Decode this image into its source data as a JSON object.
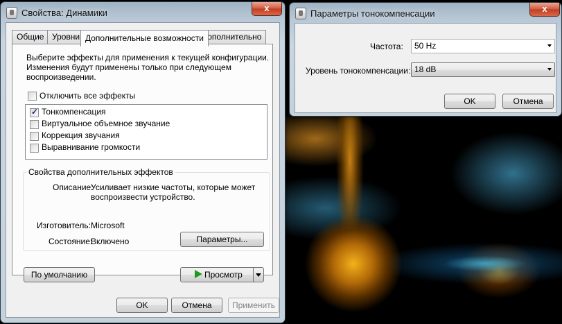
{
  "speakers_window": {
    "title": "Свойства: Динамики",
    "close_label": "x",
    "tabs": [
      "Общие",
      "Уровни",
      "Дополнительные возможности",
      "Дополнительно"
    ],
    "description": [
      "Выберите эффекты для применения к текущей конфигурации.",
      "Изменения будут применены только при следующем",
      "воспроизведении."
    ],
    "disable_all_label": "Отключить все эффекты",
    "effects": [
      {
        "label": "Тонкомпенсация",
        "checked": true
      },
      {
        "label": "Виртуальное объемное звучание",
        "checked": false
      },
      {
        "label": "Коррекция звучания",
        "checked": false
      },
      {
        "label": "Выравнивание громкости",
        "checked": false
      }
    ],
    "group_title": "Свойства дополнительных эффектов",
    "desc_label": "Описание:",
    "desc_value": [
      "Усиливает низкие частоты, которые может",
      "воспроизвести устройство."
    ],
    "vendor_label": "Изготовитель:",
    "vendor_value": "Microsoft",
    "state_label": "Состояние:",
    "state_value": "Включено",
    "params_button": "Параметры...",
    "defaults_button": "По умолчанию",
    "preview_button": "Просмотр",
    "ok": "OK",
    "cancel": "Отмена",
    "apply": "Применить"
  },
  "loudness_window": {
    "title": "Параметры тонокомпенсации",
    "close_label": "x",
    "frequency_label": "Частота:",
    "frequency_value": "50 Hz",
    "level_label": "Уровень тонокомпенсации:",
    "level_value": "18 dB",
    "ok": "OK",
    "cancel": "Отмена"
  },
  "colors": {
    "play_icon": "#1f9b1f",
    "close_button": "#c9452a"
  }
}
